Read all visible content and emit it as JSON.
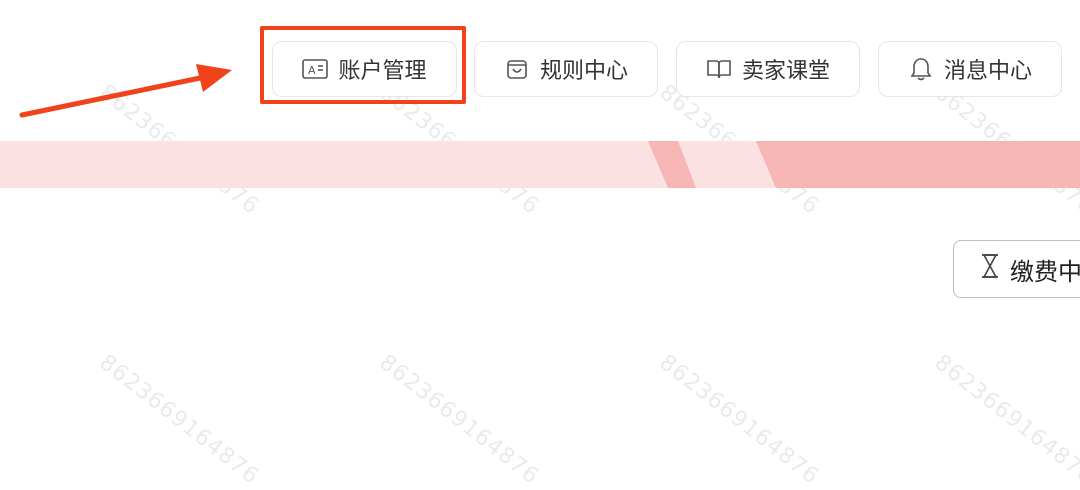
{
  "nav": {
    "items": [
      {
        "label": "账户管理",
        "icon": "id-card-icon"
      },
      {
        "label": "规则中心",
        "icon": "shield-bag-icon"
      },
      {
        "label": "卖家课堂",
        "icon": "open-book-icon"
      },
      {
        "label": "消息中心",
        "icon": "bell-icon"
      }
    ]
  },
  "pay_button": {
    "label": "缴费中",
    "icon": "hourglass-icon"
  },
  "watermark": {
    "text": "8623669164876"
  },
  "colors": {
    "highlight": "#f0431b",
    "banner_light": "#fbe1e1",
    "banner_dark": "#f6b6b3"
  }
}
